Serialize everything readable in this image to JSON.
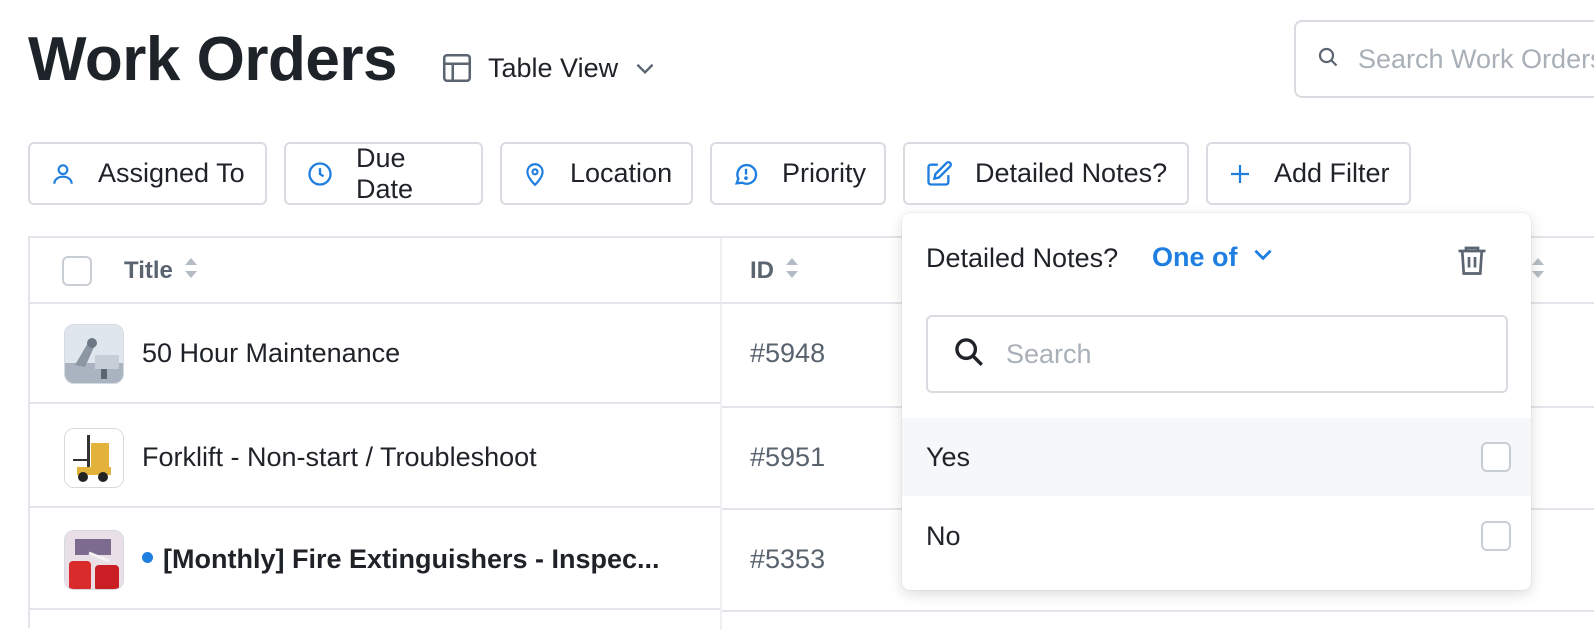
{
  "header": {
    "title": "Work Orders",
    "view_label": "Table View",
    "search_placeholder": "Search Work Orders"
  },
  "filters": [
    {
      "label": "Assigned To",
      "icon": "user-icon"
    },
    {
      "label": "Due Date",
      "icon": "clock-icon"
    },
    {
      "label": "Location",
      "icon": "location-pin-icon"
    },
    {
      "label": "Priority",
      "icon": "priority-icon"
    },
    {
      "label": "Detailed Notes?",
      "icon": "edit-icon"
    },
    {
      "label": "Add Filter",
      "icon": "plus-icon"
    }
  ],
  "table": {
    "columns": {
      "title": "Title",
      "id": "ID"
    },
    "rows": [
      {
        "title": "50 Hour Maintenance",
        "id": "#5948",
        "unread": false
      },
      {
        "title": "Forklift - Non-start / Troubleshoot",
        "id": "#5951",
        "unread": false
      },
      {
        "title": "[Monthly] Fire Extinguishers - Inspec...",
        "id": "#5353",
        "unread": true
      }
    ]
  },
  "popover": {
    "field_label": "Detailed Notes?",
    "operator_label": "One of",
    "search_placeholder": "Search",
    "options": [
      {
        "label": "Yes",
        "checked": false
      },
      {
        "label": "No",
        "checked": false
      }
    ]
  },
  "colors": {
    "accent": "#1f7fe0",
    "border": "#d8dce1",
    "text": "#1f2328",
    "muted": "#5b6571"
  }
}
